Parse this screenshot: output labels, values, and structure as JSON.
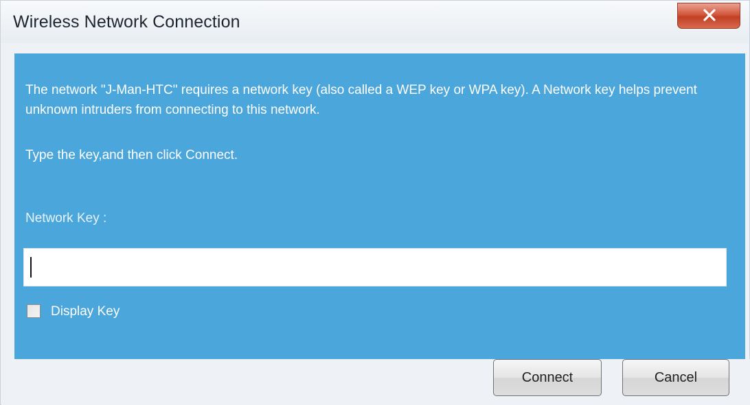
{
  "window": {
    "title": "Wireless Network Connection"
  },
  "dialog": {
    "message": "The network \"J-Man-HTC\" requires a network key (also called a WEP key or WPA key). A Network key helps prevent unknown intruders from connecting to this network.",
    "instruction": "Type the key,and then click Connect.",
    "key_label": "Network Key :",
    "key_value": "",
    "display_key_label": "Display Key",
    "display_key_checked": false
  },
  "buttons": {
    "connect": "Connect",
    "cancel": "Cancel"
  },
  "icons": {
    "close": "close-icon"
  },
  "colors": {
    "panel": "#4aa6db",
    "close_button": "#c94a2f"
  }
}
